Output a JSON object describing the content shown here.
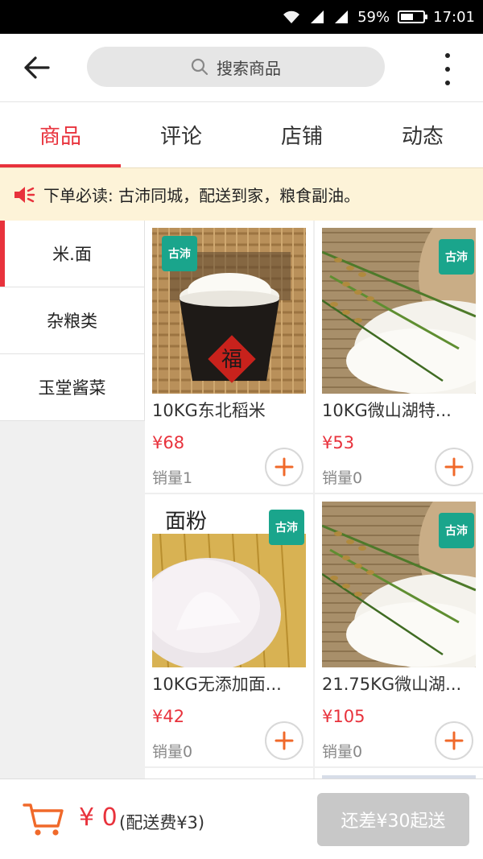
{
  "status": {
    "signal_text": "",
    "battery": "59%",
    "battery_level": 0.59,
    "time": "17:01"
  },
  "header": {
    "search_placeholder": "搜索商品"
  },
  "tabs": [
    {
      "label": "商品",
      "active": true
    },
    {
      "label": "评论",
      "active": false
    },
    {
      "label": "店铺",
      "active": false
    },
    {
      "label": "动态",
      "active": false
    }
  ],
  "notice": {
    "text": "下单必读: 古沛同城，配送到家，粮食副油。"
  },
  "categories": [
    {
      "label": "米.面",
      "active": true
    },
    {
      "label": "杂粮类",
      "active": false
    },
    {
      "label": "玉堂酱菜",
      "active": false
    }
  ],
  "products": [
    {
      "title": "10KG东北稻米",
      "price": "¥68",
      "sales": "销量1",
      "image": "rice-bowl-fu",
      "badge": "古沛"
    },
    {
      "title": "10KG微山湖特...",
      "price": "¥53",
      "sales": "销量0",
      "image": "rice-grain-ears",
      "badge": "古沛"
    },
    {
      "title": "10KG无添加面...",
      "price": "¥42",
      "sales": "销量0",
      "image": "flour-wheat-field",
      "badge_text": "面粉",
      "badge": "古沛"
    },
    {
      "title": "21.75KG微山湖...",
      "price": "¥105",
      "sales": "销量0",
      "image": "rice-grain-ears",
      "badge": "古沛"
    }
  ],
  "cart": {
    "total": "¥ 0",
    "delivery_fee": "(配送费¥3)",
    "checkout_label": "还差¥30起送"
  },
  "colors": {
    "accent": "#e8323c",
    "notice_bg": "#fdf3d8",
    "cart_orange": "#f0692a",
    "badge_green": "#1aa58c"
  }
}
